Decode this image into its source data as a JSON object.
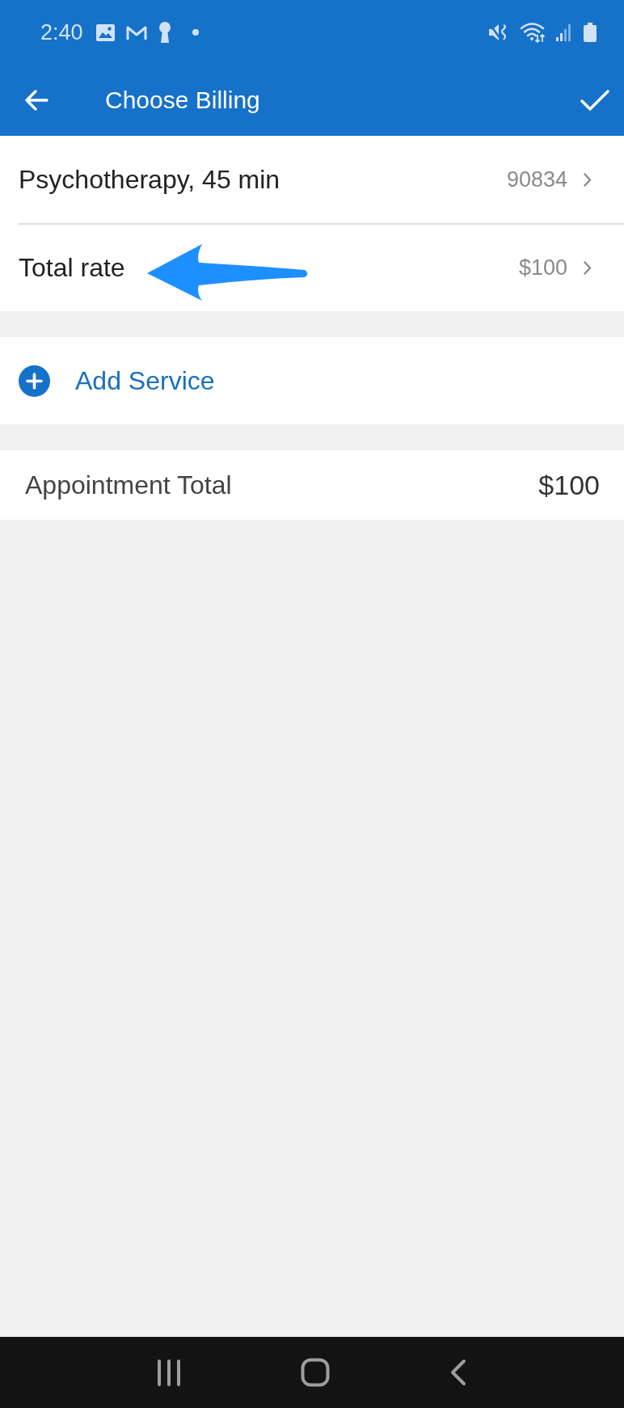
{
  "status_bar": {
    "time": "2:40"
  },
  "toolbar": {
    "title": "Choose Billing"
  },
  "services": [
    {
      "name": "Psychotherapy, 45 min",
      "value": "90834",
      "annotated": false
    },
    {
      "name": "Total rate",
      "value": "$100",
      "annotated": true
    }
  ],
  "add_service": {
    "label": "Add Service"
  },
  "appointment_total": {
    "label": "Appointment Total",
    "amount": "$100"
  }
}
